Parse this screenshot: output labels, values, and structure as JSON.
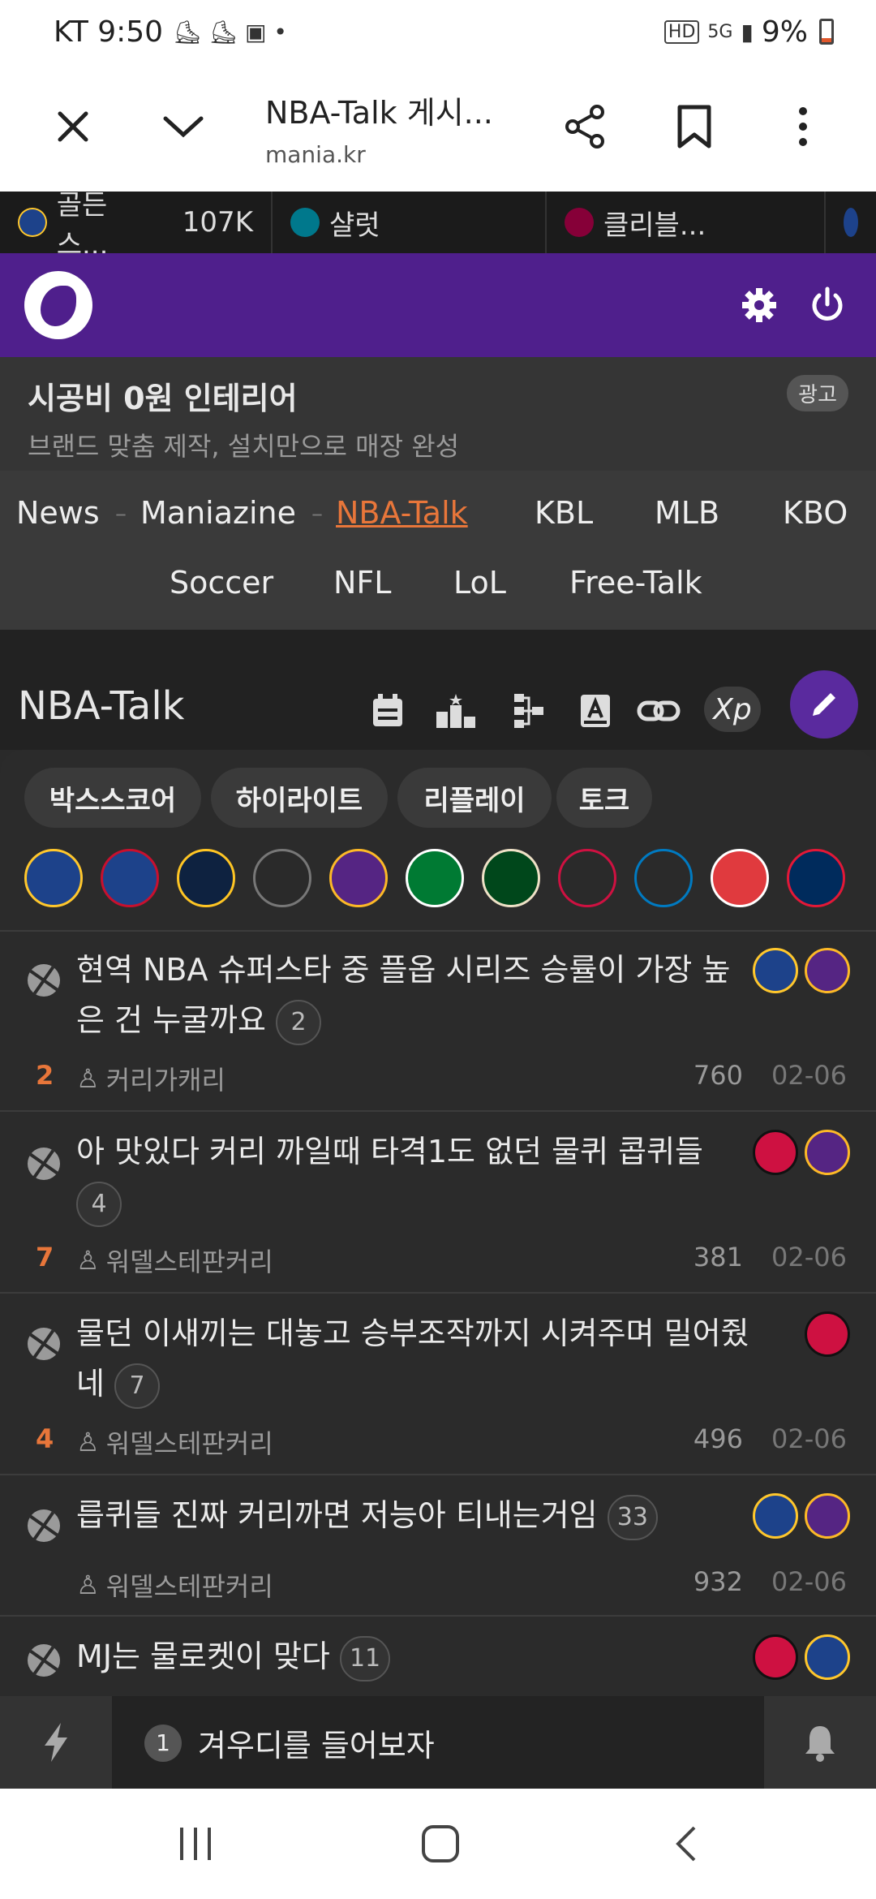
{
  "status_bar": {
    "carrier_time": "KT 9:50",
    "network": "5G",
    "battery": "9%"
  },
  "browser": {
    "title": "NBA-Talk 게시...",
    "url": "mania.kr"
  },
  "team_tabs": [
    {
      "label": "골든스...",
      "count": "107K",
      "color": "#1d428a"
    },
    {
      "label": "샬럿",
      "count": "",
      "color": "#1d1160"
    },
    {
      "label": "클리블...",
      "count": "",
      "color": "#860038"
    }
  ],
  "ad": {
    "title": "시공비 0원 인테리어",
    "subtitle": "브랜드 맞춤 제작, 설치만으로 매장 완성",
    "badge": "광고"
  },
  "categories": {
    "items": [
      "News",
      "Maniazine",
      "NBA-Talk",
      "KBL",
      "MLB",
      "KBO",
      "Soccer",
      "NFL",
      "LoL",
      "Free-Talk"
    ],
    "active": "NBA-Talk"
  },
  "board": {
    "title": "NBA-Talk",
    "xp_label": "Xp"
  },
  "chips": [
    "박스스코어",
    "하이라이트",
    "리플레이",
    "토크"
  ],
  "team_logos": [
    {
      "name": "warriors-logo",
      "color": "#1d428a"
    },
    {
      "name": "clippers-logo",
      "color": "#1d428a"
    },
    {
      "name": "nuggets-logo",
      "color": "#0e2240"
    },
    {
      "name": "jazz-logo",
      "color": "#2a2a2a"
    },
    {
      "name": "lakers-logo",
      "color": "#552583"
    },
    {
      "name": "celtics-logo",
      "color": "#007a33"
    },
    {
      "name": "bucks-logo",
      "color": "#00471b"
    },
    {
      "name": "rockets-logo",
      "color": "#2a2a2a"
    },
    {
      "name": "thunder-logo",
      "color": "#2a2a2a"
    },
    {
      "name": "hawks-logo",
      "color": "#e03a3e"
    },
    {
      "name": "wizards-logo",
      "color": "#002b5c"
    }
  ],
  "posts": [
    {
      "title": "현역 NBA 슈퍼스타 중 플옵 시리즈 승률이 가장 높은 건 누굴까요",
      "comments": "2",
      "rec": "2",
      "author": "커리가캐리",
      "views": "760",
      "date": "02-06",
      "teams": [
        "warriors",
        "lakers"
      ]
    },
    {
      "title": "아 맛있다 커리 까일때 타격1도 없던 물퀴 콥퀴들",
      "comments": "4",
      "rec": "7",
      "author": "워델스테판커리",
      "views": "381",
      "date": "02-06",
      "teams": [
        "bulls",
        "lakers"
      ]
    },
    {
      "title": "물던 이새끼는 대놓고 승부조작까지 시켜주며 밀어줬네",
      "comments": "7",
      "rec": "4",
      "author": "워델스테판커리",
      "views": "496",
      "date": "02-06",
      "teams": [
        "bulls"
      ]
    },
    {
      "title": "릅퀴들 진짜 커리까면 저능아 티내는거임",
      "comments": "33",
      "rec": "",
      "author": "워델스테판커리",
      "views": "932",
      "date": "02-06",
      "teams": [
        "warriors",
        "lakers"
      ]
    },
    {
      "title": "MJ는 물로켓이 맞다",
      "comments": "11",
      "rec": "",
      "author": "",
      "views": "",
      "date": "",
      "teams": [
        "bulls",
        "warriors"
      ]
    }
  ],
  "bottom_bar": {
    "ticker_num": "1",
    "ticker_text": "겨우디를 들어보자"
  },
  "colors": {
    "accent": "#e8763a",
    "brand_purple": "#4f1f8c",
    "write_button": "#5a2a9e"
  }
}
